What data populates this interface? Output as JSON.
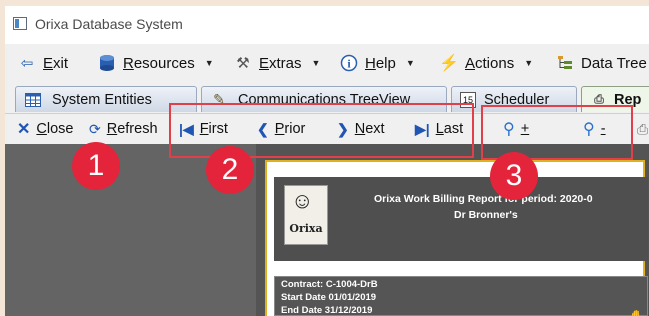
{
  "window": {
    "title": "Orixa Database System"
  },
  "menu": {
    "items": [
      {
        "label": "Exit",
        "icon": "exit-icon"
      },
      {
        "label": "Resources",
        "icon": "database-icon"
      },
      {
        "label": "Extras",
        "icon": "tools-icon"
      },
      {
        "label": "Help",
        "icon": "help-icon"
      },
      {
        "label": "Actions",
        "icon": "lightning-icon"
      },
      {
        "label": "Data Tree",
        "icon": "tree-icon"
      }
    ]
  },
  "tabs": [
    {
      "label": "System Entities",
      "icon": "grid-icon"
    },
    {
      "label": "Communications TreeView",
      "icon": "pen-icon"
    },
    {
      "label": "Scheduler",
      "icon": "calendar-icon",
      "icon_text": "15"
    },
    {
      "label": "Rep",
      "icon": "printer-icon",
      "active": true
    }
  ],
  "toolbar": {
    "close": "Close",
    "refresh": "Refresh",
    "first": "First",
    "prior": "Prior",
    "next": "Next",
    "last": "Last",
    "zoom_in": "+",
    "zoom_out": "-"
  },
  "report": {
    "logo_text": "Orixa",
    "title": "Orixa Work Billing Report for period: 2020-0",
    "subtitle": "Dr Bronner's",
    "contract": "Contract: C-1004-DrB",
    "start_date": "Start Date  01/01/2019",
    "end_date": "End Date    31/12/2019"
  },
  "callouts": [
    "1",
    "2",
    "3"
  ],
  "colors": {
    "highlight": "#e0404a",
    "badge": "#e3243a",
    "toolbar_icon": "#1f55b3",
    "page_border": "#e0b01e"
  }
}
